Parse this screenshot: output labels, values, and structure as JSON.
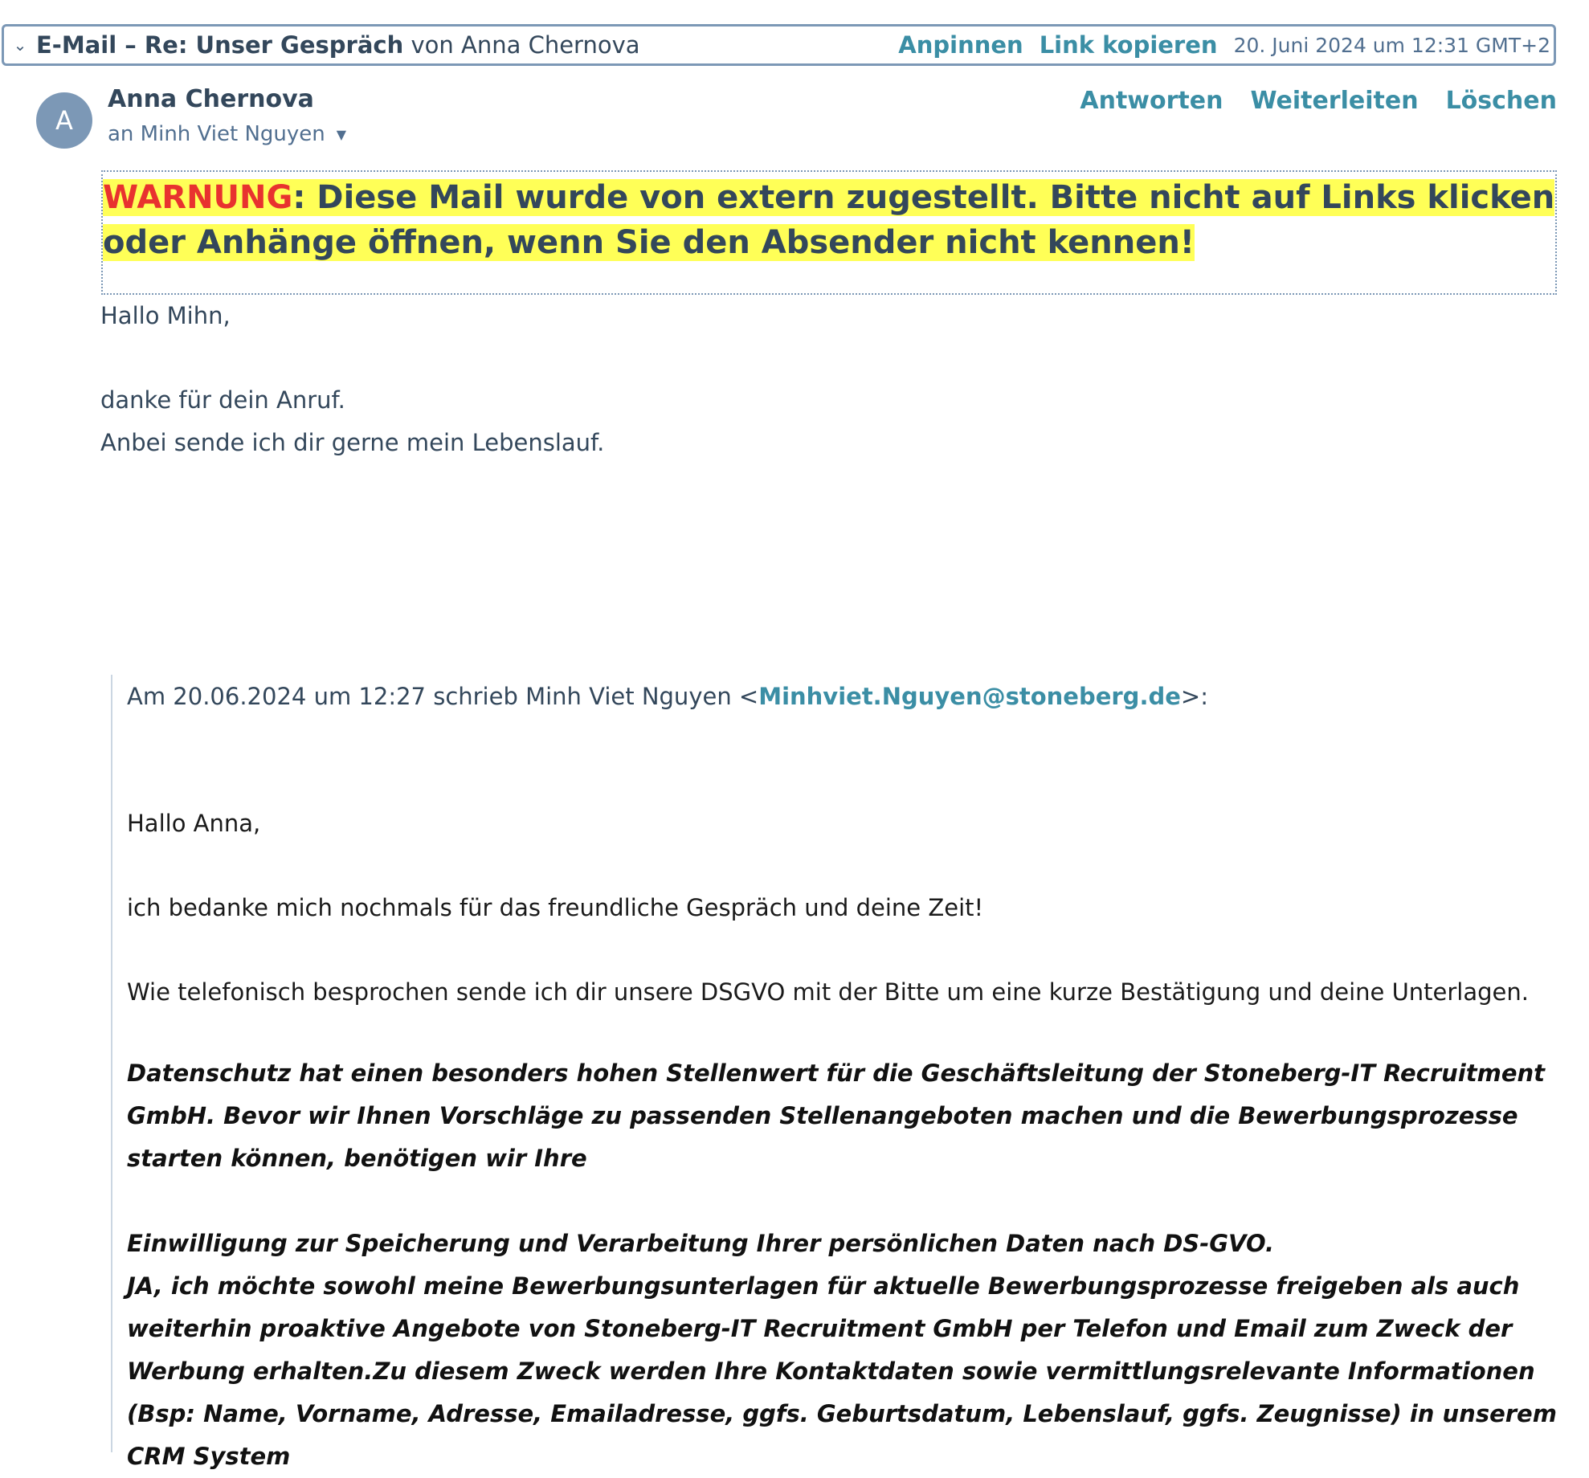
{
  "header": {
    "subject_prefix": "E-Mail – Re: Unser Gespräch",
    "subject_from": "von Anna Chernova",
    "pin_label": "Anpinnen",
    "copy_link_label": "Link kopieren",
    "date": "20. Juni 2024 um 12:31 GMT+2"
  },
  "message": {
    "avatar_initial": "A",
    "sender": "Anna Chernova",
    "recipient": "an Minh Viet Nguyen",
    "actions": {
      "reply": "Antworten",
      "forward": "Weiterleiten",
      "delete": "Löschen"
    },
    "warning": {
      "label": "WARNUNG",
      "text": ": Diese Mail wurde von extern zugestellt. Bitte nicht auf Links klicken oder Anhänge öffnen, wenn Sie den Absender nicht kennen!"
    },
    "greeting": "Hallo Mihn,",
    "line1": "danke für dein Anruf.",
    "line2": "Anbei sende ich dir gerne mein Lebenslauf."
  },
  "quoted": {
    "intro_prefix": "Am 20.06.2024 um 12:27 schrieb Minh Viet Nguyen <",
    "intro_email": "Minhviet.Nguyen@stoneberg.de",
    "intro_suffix": ">:",
    "greeting": "Hallo Anna,",
    "line1": "ich bedanke mich nochmals für das freundliche Gespräch und deine Zeit!",
    "line2": "Wie telefonisch besprochen sende ich dir unsere DSGVO mit der Bitte um eine kurze Bestätigung und deine Unterlagen.",
    "legal1": "Datenschutz hat einen besonders hohen Stellenwert für die Geschäftsleitung der Stoneberg-IT Recruitment GmbH. Bevor wir Ihnen Vorschläge zu passenden Stellenangeboten machen und die Bewerbungsprozesse starten können, benötigen wir Ihre",
    "legal2_title": "Einwilligung zur Speicherung und Verarbeitung Ihrer persönlichen Daten nach DS-GVO.",
    "legal2_body": "JA, ich möchte sowohl meine Bewerbungsunterlagen für aktuelle Bewerbungsprozesse freigeben als auch weiterhin proaktive Angebote von Stoneberg-IT Recruitment GmbH per Telefon und Email zum Zweck der Werbung erhalten.Zu diesem Zweck werden Ihre Kontaktdaten sowie vermittlungsrelevante Informationen (Bsp: Name, Vorname, Adresse, Emailadresse, ggfs. Geburtsdatum, Lebenslauf, ggfs. Zeugnisse) in unserem CRM System"
  }
}
